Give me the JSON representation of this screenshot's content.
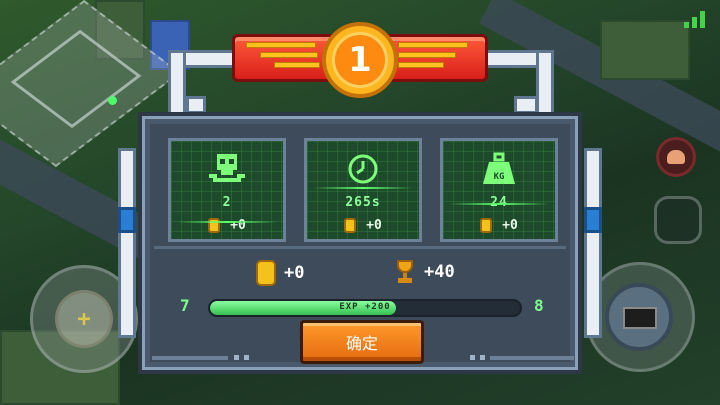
{
  "hud": {
    "signal_icon": "signal-bars-icon",
    "joystick_icon": "plus-icon",
    "joystick_symbol": "+",
    "nuke_icon": "mushroom-cloud-icon",
    "camera_icon": "camera-icon"
  },
  "result": {
    "rank": "1",
    "stats": [
      {
        "icon": "skull-icon",
        "value": "2",
        "reward": "+0"
      },
      {
        "icon": "clock-icon",
        "value": "265s",
        "reward": "+0"
      },
      {
        "icon": "weight-kg-icon",
        "value": "24",
        "reward": "+0"
      }
    ],
    "total_coins": "+0",
    "total_trophies": "+40",
    "level_current": "7",
    "level_next": "8",
    "exp_label": "EXP +200",
    "exp_progress": 0.6,
    "confirm_label": "确定"
  },
  "colors": {
    "accent_green": "#8cff9a",
    "banner_red": "#d8201a",
    "confirm_orange": "#ff9a2a",
    "coin_gold": "#f4c21a"
  }
}
